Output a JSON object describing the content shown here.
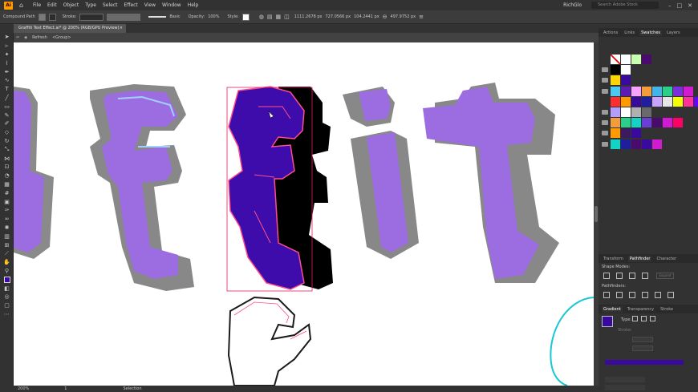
{
  "app": {
    "logo": "Ai",
    "user": "RichGlo",
    "search_placeholder": "Search Adobe Stock"
  },
  "menu": [
    "File",
    "Edit",
    "Object",
    "Type",
    "Select",
    "Effect",
    "View",
    "Window",
    "Help"
  ],
  "control_bar": {
    "selection_type": "Compound Path",
    "stroke_label": "Stroke:",
    "stroke_style": "Basic",
    "opacity_label": "Opacity:",
    "opacity_value": "100%",
    "style_label": "Style:",
    "x_value": "1111.2678 px",
    "y_value": "727.0566 px",
    "w_value": "104.2441 px",
    "h_value": "497.9752 px"
  },
  "document_tab": {
    "title": "Graffiti Text Effect.ai* @ 200% (RGB/GPU Preview)",
    "close": "×"
  },
  "breadcrumb": {
    "layer": "Refresh",
    "group": "<Group>"
  },
  "status": {
    "zoom": "200%",
    "page": "1",
    "tool": "Selection"
  },
  "panel_tabs_top": [
    {
      "label": "Actions",
      "active": false
    },
    {
      "label": "Links",
      "active": false
    },
    {
      "label": "Swatches",
      "active": true
    },
    {
      "label": "Layers",
      "active": false
    }
  ],
  "panel_tabs_mid": [
    {
      "label": "Transform",
      "active": false
    },
    {
      "label": "Pathfinder",
      "active": true
    },
    {
      "label": "Character",
      "active": false
    }
  ],
  "pathfinder": {
    "shape_modes": "Shape Modes:",
    "pathfinders": "Pathfinders:",
    "expand": "Expand"
  },
  "panel_tabs_bottom": [
    {
      "label": "Gradient",
      "active": true
    },
    {
      "label": "Transparency",
      "active": false
    },
    {
      "label": "Stroke",
      "active": false
    }
  ],
  "gradient": {
    "type_label": "Type:",
    "stroke_label": "Stroke:",
    "fill_color": "#3a0a9e"
  },
  "swatch_rows": [
    {
      "folder": false,
      "colors": [
        "none",
        "#ffffff",
        "#c9ffb0",
        "#4b0a6e"
      ]
    },
    {
      "folder": true,
      "colors": [
        "#000000",
        "#ffffff"
      ]
    },
    {
      "folder": true,
      "colors": [
        "#ffd400",
        "#3a0a9e"
      ]
    },
    {
      "folder": true,
      "colors": [
        "#4cc9f0",
        "#5e1bb3",
        "#f7a3ff",
        "#f39c3d",
        "#3fb5e8",
        "#2ad08a",
        "#7b2fe0",
        "#d11bd1"
      ]
    },
    {
      "folder": false,
      "colors": [
        "#ff2d2d",
        "#ff9900",
        "#3a0a9e",
        "#1f1f9e",
        "#c9a3ff",
        "#e6e6e6",
        "#f6ff00",
        "#ff3399",
        "#6a00ff"
      ]
    },
    {
      "folder": true,
      "colors": [
        "#b39dff",
        "#ffffff",
        "#b0b0b0",
        "#6a6a6a"
      ]
    },
    {
      "folder": true,
      "colors": [
        "#f39c3d",
        "#2ad08a",
        "#13d3c7",
        "#6a3fd6",
        "#4b0a6e",
        "#d11bd1",
        "#ff0066"
      ]
    },
    {
      "folder": true,
      "colors": [
        "#ff9a00",
        "#3b1b5e",
        "#3a0a9e"
      ]
    },
    {
      "folder": true,
      "colors": [
        "#13d3c7",
        "#1f1f9e",
        "#4b0a6e",
        "#3a0a9e",
        "#d11bd1"
      ]
    }
  ],
  "colors": {
    "accent_selection": "#e2245a",
    "letter_purple": "#9b6de0",
    "letter_shadow": "#888888",
    "selected_fill": "#3a0a9e",
    "cyan_path": "#19c7d4"
  }
}
